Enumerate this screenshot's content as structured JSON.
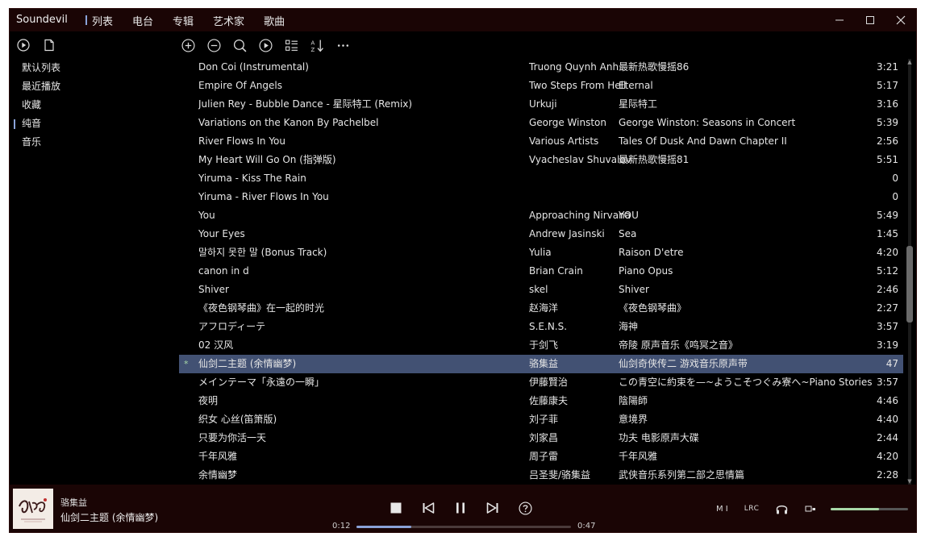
{
  "app": {
    "title": "Soundevil"
  },
  "nav": {
    "tabs": [
      "列表",
      "电台",
      "专辑",
      "艺术家",
      "歌曲"
    ],
    "active_index": 0
  },
  "sidebar": {
    "items": [
      "默认列表",
      "最近播放",
      "收藏",
      "纯音",
      "音乐"
    ],
    "active_index": 3
  },
  "tracks": [
    {
      "title": "Don Coi (Instrumental)",
      "artist": "Truong Quynh Anh",
      "album": "最新热歌慢摇86",
      "duration": "3:21"
    },
    {
      "title": "Empire Of Angels",
      "artist": "Two Steps From Hell",
      "album": "Eternal",
      "duration": "5:17"
    },
    {
      "title": "Julien Rey - Bubble Dance - 星际特工 (Remix)",
      "artist": "Urkuji",
      "album": "星际特工",
      "duration": "3:16"
    },
    {
      "title": "Variations on the Kanon By Pachelbel",
      "artist": "George Winston",
      "album": "George Winston: Seasons in Concert",
      "duration": "5:39"
    },
    {
      "title": "River Flows In You",
      "artist": "Various Artists",
      "album": "Tales Of Dusk And Dawn Chapter II",
      "duration": "2:56"
    },
    {
      "title": "My Heart Will Go On (指弹版)",
      "artist": "Vyacheslav Shuvalov",
      "album": "最新热歌慢摇81",
      "duration": "5:51"
    },
    {
      "title": "Yiruma - Kiss The Rain",
      "artist": "",
      "album": "",
      "duration": "0"
    },
    {
      "title": "Yiruma - River Flows In You",
      "artist": "",
      "album": "",
      "duration": "0"
    },
    {
      "title": "You",
      "artist": "Approaching Nirvana",
      "album": "YOU",
      "duration": "5:49"
    },
    {
      "title": "Your Eyes",
      "artist": "Andrew Jasinski",
      "album": "Sea",
      "duration": "1:45"
    },
    {
      "title": "말하지 못한 말 (Bonus Track)",
      "artist": "Yulia",
      "album": "Raison D'etre",
      "duration": "4:20"
    },
    {
      "title": "canon in d",
      "artist": "Brian Crain",
      "album": "Piano Opus",
      "duration": "5:12"
    },
    {
      "title": "Shiver",
      "artist": "skel",
      "album": "Shiver",
      "duration": "2:46"
    },
    {
      "title": "《夜色钢琴曲》在一起的时光",
      "artist": "赵海洋",
      "album": "《夜色钢琴曲》",
      "duration": "2:27"
    },
    {
      "title": "アフロディーテ",
      "artist": "S.E.N.S.",
      "album": "海神",
      "duration": "3:57"
    },
    {
      "title": "02 汉风",
      "artist": "于剑飞",
      "album": "帝陵 原声音乐《鸣冥之音》",
      "duration": "3:19"
    },
    {
      "title": "仙剑二主题 (余情幽梦)",
      "artist": "骆集益",
      "album": "仙剑奇侠传二 游戏音乐原声带",
      "duration": "47"
    },
    {
      "title": "メインテーマ「永遠の一瞬」",
      "artist": "伊藤賢治",
      "album": "この青空に約束を—~ようこそつぐみ寮へ~Piano Stories",
      "duration": "3:57"
    },
    {
      "title": "夜明",
      "artist": "佐藤康夫",
      "album": "陰陽師",
      "duration": "4:46"
    },
    {
      "title": "织女 心丝(笛箫版)",
      "artist": "刘子菲",
      "album": "意境界",
      "duration": "4:40"
    },
    {
      "title": "只要为你活一天",
      "artist": "刘家昌",
      "album": "功夫 电影原声大碟",
      "duration": "2:44"
    },
    {
      "title": "千年风雅",
      "artist": "周子雷",
      "album": "千年风雅",
      "duration": "4:20"
    },
    {
      "title": "余情幽梦",
      "artist": "吕圣斐/骆集益",
      "album": "武侠音乐系列第二部之思情篇",
      "duration": "2:28"
    }
  ],
  "selected_index": 16,
  "playing_marker": "*",
  "player": {
    "artist": "骆集益",
    "title": "仙剑二主题 (余情幽梦)",
    "time_current": "0:12",
    "time_total": "0:47",
    "progress_fraction": 0.255,
    "volume_fraction": 0.62,
    "mode_label": "M I",
    "lyrics_label": "LRC"
  },
  "colors": {
    "accent": "#8aa2d8",
    "selected_row": "#425173",
    "titlebar": "#1a0505",
    "volume": "#a8d8a8"
  },
  "icons": {
    "side_tools": [
      "play-circle-icon",
      "new-list-icon"
    ],
    "list_tools": [
      "add-icon",
      "remove-icon",
      "search-icon",
      "locate-playing-icon",
      "list-view-icon",
      "sort-icon",
      "more-icon"
    ],
    "controls": [
      "stop-icon",
      "previous-icon",
      "pause-icon",
      "next-icon",
      "help-icon"
    ]
  }
}
